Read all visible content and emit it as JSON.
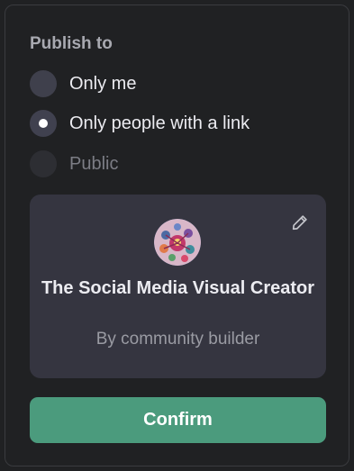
{
  "publish": {
    "heading": "Publish to",
    "options": [
      {
        "label": "Only me",
        "state": "unselected"
      },
      {
        "label": "Only people with a link",
        "state": "selected"
      },
      {
        "label": "Public",
        "state": "disabled"
      }
    ]
  },
  "card": {
    "title": "The Social Media Visual Creator",
    "byline": "By community builder",
    "edit_icon": "pencil-icon"
  },
  "confirm_label": "Confirm",
  "colors": {
    "background": "#202123",
    "card": "#353540",
    "accent": "#4b9b7d"
  }
}
